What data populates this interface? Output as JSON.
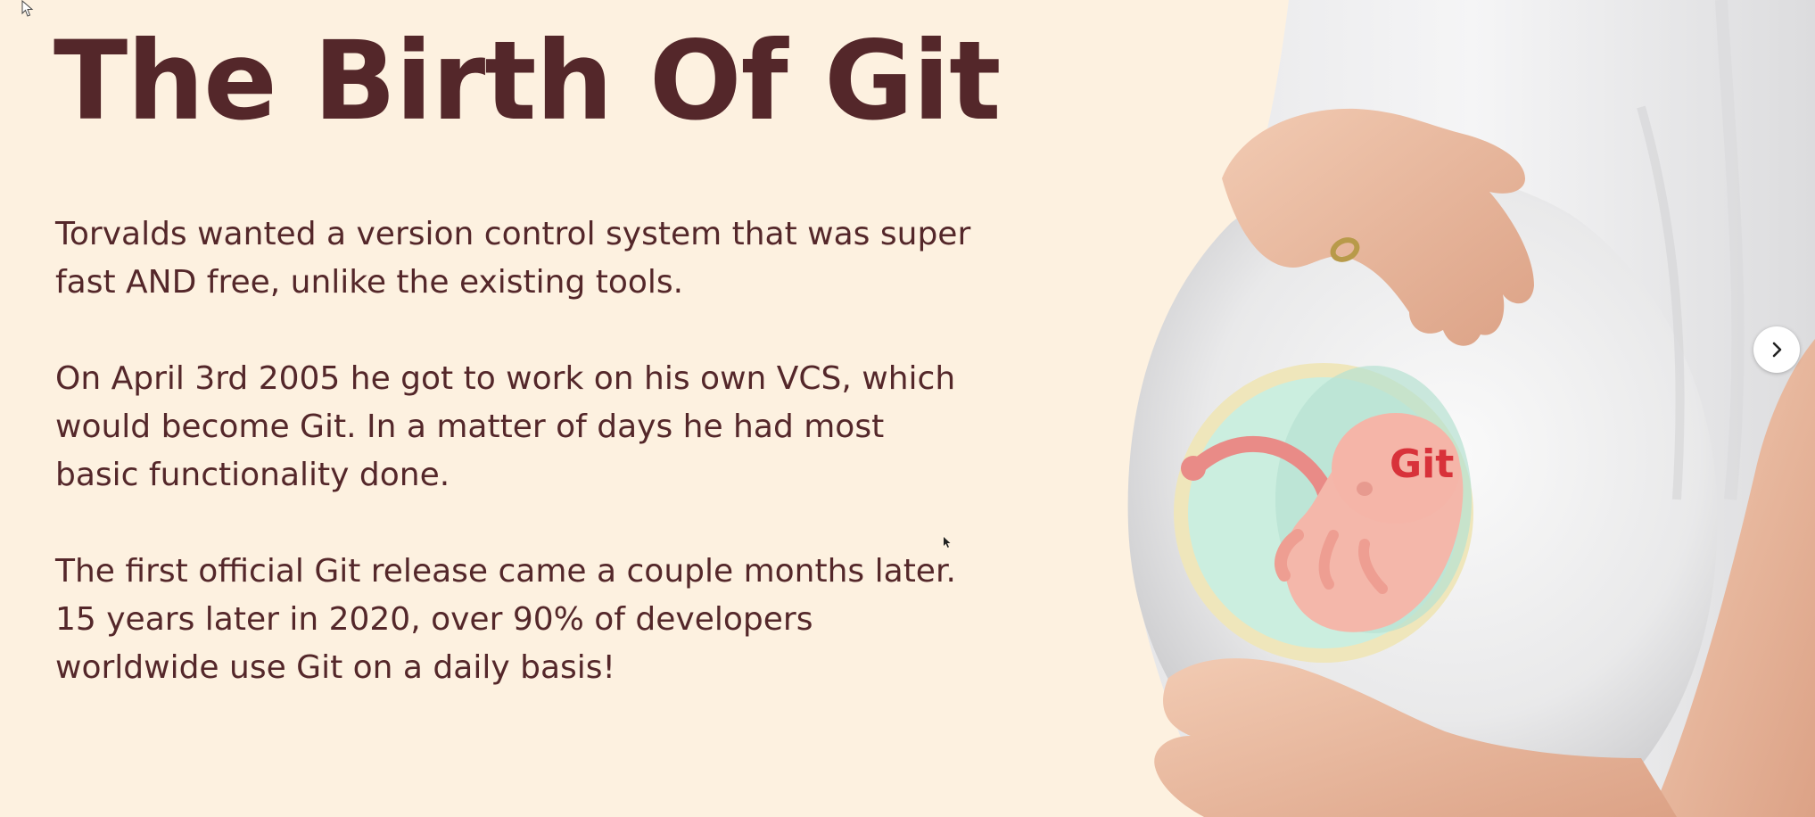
{
  "slide": {
    "title": "The Birth Of Git",
    "paragraphs": [
      {
        "lines": [
          "Torvalds wanted a version control system that was super",
          "fast AND free, unlike the existing tools."
        ]
      },
      {
        "lines": [
          "On April 3rd 2005 he got to work on his own VCS, which",
          "would become Git.  In a matter of days he had most",
          "basic functionality done."
        ]
      },
      {
        "lines": [
          "The first official Git release came a couple months later.",
          "15 years later in 2020, over 90% of developers",
          "worldwide use Git on a daily basis!"
        ]
      }
    ]
  },
  "image": {
    "embryo_label": "Git",
    "icon": "pregnant-belly-with-embryo-illustration"
  },
  "controls": {
    "next_icon": "chevron-right-icon"
  },
  "colors": {
    "background": "#fdf1e0",
    "text": "#54272a",
    "embryo_label": "#d8323a"
  }
}
